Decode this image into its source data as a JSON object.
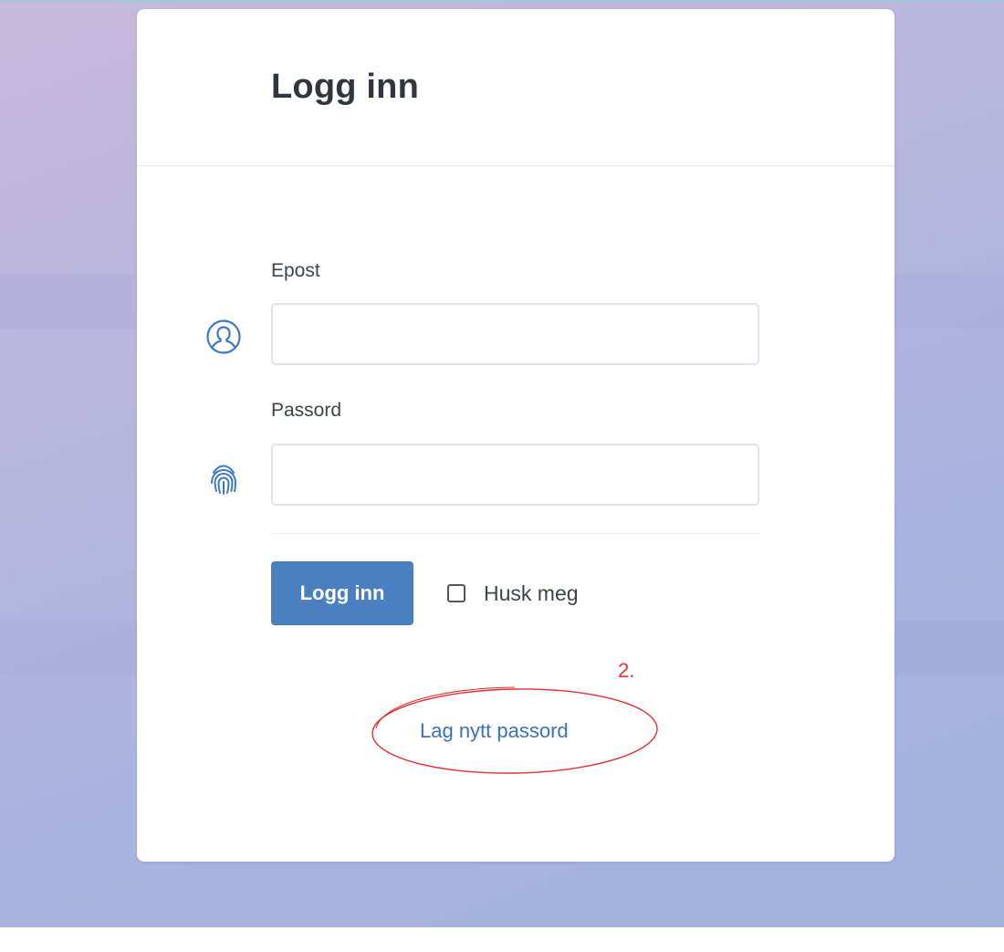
{
  "card": {
    "title": "Logg inn"
  },
  "form": {
    "email": {
      "label": "Epost",
      "value": "",
      "placeholder": "",
      "icon": "user-circle-icon"
    },
    "password": {
      "label": "Passord",
      "value": "",
      "placeholder": "",
      "icon": "fingerprint-icon"
    },
    "submit_label": "Logg inn",
    "remember": {
      "label": "Husk meg",
      "checked": false
    },
    "reset_link_label": "Lag nytt passord"
  },
  "annotation": {
    "number": "2.",
    "color": "#e03030"
  },
  "colors": {
    "accent": "#4a7fc1",
    "link": "#3a73b5",
    "icon": "#3b78c4"
  }
}
